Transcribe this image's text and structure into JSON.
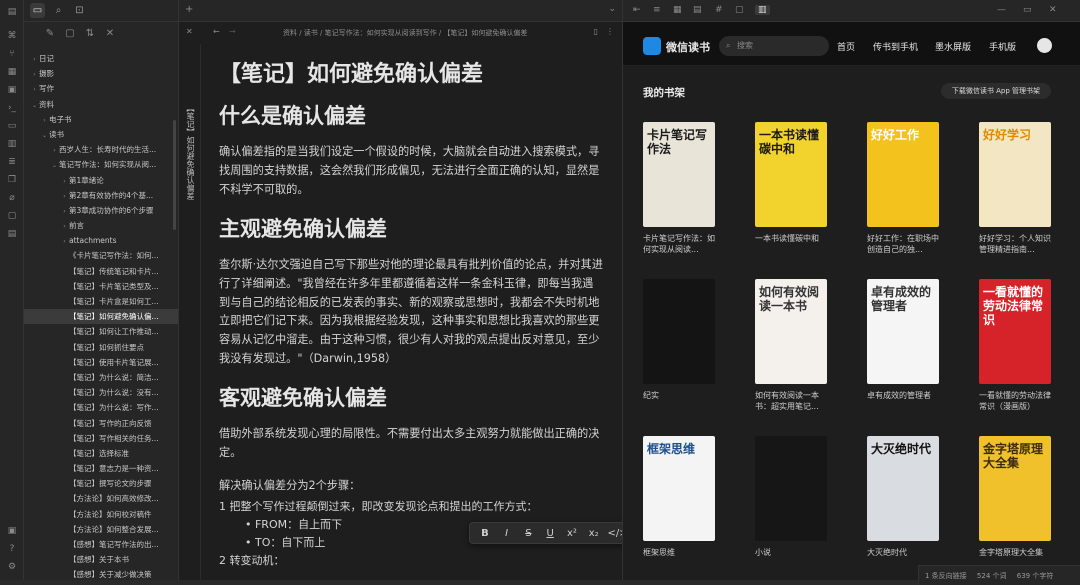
{
  "sidebar": {
    "tree": [
      {
        "label": "日记",
        "indent": 0,
        "chev": "›"
      },
      {
        "label": "摄影",
        "indent": 0,
        "chev": "›"
      },
      {
        "label": "写作",
        "indent": 0,
        "chev": "›"
      },
      {
        "label": "资料",
        "indent": 0,
        "chev": "⌄"
      },
      {
        "label": "电子书",
        "indent": 1,
        "chev": "›"
      },
      {
        "label": "读书",
        "indent": 1,
        "chev": "⌄"
      },
      {
        "label": "西岁人生：长寿时代的生活...",
        "indent": 2,
        "chev": "›"
      },
      {
        "label": "笔记写作法：如何实现从阅...",
        "indent": 2,
        "chev": "⌄"
      },
      {
        "label": "第1章绪论",
        "indent": 3,
        "chev": "›"
      },
      {
        "label": "第2章有效协作的4个基...",
        "indent": 3,
        "chev": "›"
      },
      {
        "label": "第3章成功协作的6个步骤",
        "indent": 3,
        "chev": "›"
      },
      {
        "label": "前言",
        "indent": 3,
        "chev": "›"
      },
      {
        "label": "attachments",
        "indent": 3,
        "chev": "›"
      },
      {
        "label": "《卡片笔记写作法：如何...",
        "indent": 3,
        "chev": ""
      },
      {
        "label": "【笔记】传统笔记和卡片...",
        "indent": 3,
        "chev": ""
      },
      {
        "label": "【笔记】卡片笔记类型及...",
        "indent": 3,
        "chev": ""
      },
      {
        "label": "【笔记】卡片盒是如何工...",
        "indent": 3,
        "chev": ""
      },
      {
        "label": "【笔记】如何避免确认偏...",
        "indent": 3,
        "chev": "",
        "sel": true
      },
      {
        "label": "【笔记】如何让工作推动...",
        "indent": 3,
        "chev": ""
      },
      {
        "label": "【笔记】如何抓住要点",
        "indent": 3,
        "chev": ""
      },
      {
        "label": "【笔记】使用卡片笔记展...",
        "indent": 3,
        "chev": ""
      },
      {
        "label": "【笔记】为什么说：简洁...",
        "indent": 3,
        "chev": ""
      },
      {
        "label": "【笔记】为什么说：没有...",
        "indent": 3,
        "chev": ""
      },
      {
        "label": "【笔记】为什么说：写作...",
        "indent": 3,
        "chev": ""
      },
      {
        "label": "【笔记】写作的正向反馈",
        "indent": 3,
        "chev": ""
      },
      {
        "label": "【笔记】写作相关的任务...",
        "indent": 3,
        "chev": ""
      },
      {
        "label": "【笔记】选择标准",
        "indent": 3,
        "chev": ""
      },
      {
        "label": "【笔记】意志力是一种资...",
        "indent": 3,
        "chev": ""
      },
      {
        "label": "【笔记】撰写论文的步骤",
        "indent": 3,
        "chev": ""
      },
      {
        "label": "【方法论】如何高效修改...",
        "indent": 3,
        "chev": ""
      },
      {
        "label": "【方法论】如何校对稿件",
        "indent": 3,
        "chev": ""
      },
      {
        "label": "【方法论】如何整合发展...",
        "indent": 3,
        "chev": ""
      },
      {
        "label": "【感想】笔记写作法的出...",
        "indent": 3,
        "chev": ""
      },
      {
        "label": "【感想】关于本书",
        "indent": 3,
        "chev": ""
      },
      {
        "label": "【感想】关于减少做决策",
        "indent": 3,
        "chev": ""
      }
    ]
  },
  "editor": {
    "breadcrumb": "资料 / 读书 / 笔记写作法：如何实现从阅读到写作 / 【笔记】如何避免确认偏差",
    "vertical_tab": "【笔记】如何避免确认偏差",
    "title": "【笔记】如何避免确认偏差",
    "h2_1": "什么是确认偏差",
    "p1": "确认偏差指的是当我们设定一个假设的时候，大脑就会自动进入搜索模式，寻找周围的支持数据，这会然我们形成偏见，无法进行全面正确的认知，显然是不科学不可取的。",
    "h2_2": "主观避免确认偏差",
    "p2": "查尔斯·达尔文强迫自己写下那些对他的理论最具有批判价值的论点，并对其进行了详细阐述。\"我曾经在许多年里都遵循着这样一条金科玉律，即每当我遇到与自己的结论相反的已发表的事实、新的观察或思想时，我都会不失时机地立即把它们记下来。因为我根据经验发现，这种事实和思想比我喜欢的那些更容易从记忆中溜走。由于这种习惯，很少有人对我的观点提出反对意见，至少我没有发现过。\"（Darwin,1958）",
    "h2_3": "客观避免确认偏差",
    "p3": "借助外部系统发现心理的局限性。不需要付出太多主观努力就能做出正确的决定。",
    "p4": "解决确认偏差分为2个步骤：",
    "li1": "1  把整个写作过程颠倒过来，即改变发现论点和提出的工作方式：",
    "li1a": "•  FROM：自上而下",
    "li1b": "•  TO：自下而上",
    "li2": "2  转变动机：",
    "toolbar": [
      "B",
      "I",
      "S",
      "U",
      "x²",
      "x₂",
      "</>",
      "▭",
      "❝"
    ]
  },
  "weread": {
    "name": "微信读书",
    "search_placeholder": "搜索",
    "nav": [
      "首页",
      "传书到手机",
      "墨水屏版",
      "手机版"
    ],
    "shelf_title": "我的书架",
    "download_btn": "下载微信读书 App 管理书架",
    "books": [
      {
        "title": "卡片笔记写作法：如何实现从阅读...",
        "cover_text": "卡片笔记写作法",
        "bg": "#e9e4d8",
        "fg": "#1a1a1a"
      },
      {
        "title": "一本书读懂碳中和",
        "cover_text": "一本书读懂碳中和",
        "bg": "#f2d22c",
        "fg": "#1a1a1a"
      },
      {
        "title": "好好工作：在职场中创造自己的独...",
        "cover_text": "好好工作",
        "bg": "#f3c21c",
        "fg": "#ffffff"
      },
      {
        "title": "好好学习：个人知识管理精进指南...",
        "cover_text": "好好学习",
        "bg": "#f2e6c3",
        "fg": "#e08a00"
      },
      {
        "title": "纪实",
        "cover_text": "",
        "bg": "#141414",
        "fg": "#ffffff"
      },
      {
        "title": "如何有效阅读一本书：超实用笔记...",
        "cover_text": "如何有效阅读一本书",
        "bg": "#f4f1ec",
        "fg": "#333333"
      },
      {
        "title": "卓有成效的管理者",
        "cover_text": "卓有成效的管理者",
        "bg": "#f5f5f5",
        "fg": "#333333"
      },
      {
        "title": "一看就懂的劳动法律常识（漫画版）",
        "cover_text": "一看就懂的劳动法律常识",
        "bg": "#d6232a",
        "fg": "#ffffff"
      },
      {
        "title": "框架思维",
        "cover_text": "框架思维",
        "bg": "#f4f4f4",
        "fg": "#1d4f8f"
      },
      {
        "title": "小说",
        "cover_text": "",
        "bg": "#161616",
        "fg": "#ffffff"
      },
      {
        "title": "大灭绝时代",
        "cover_text": "大灭绝时代",
        "bg": "#d9dde1",
        "fg": "#111111"
      },
      {
        "title": "金字塔原理大全集",
        "cover_text": "金字塔原理大全集",
        "bg": "#f1c12b",
        "fg": "#3b2a10"
      }
    ]
  },
  "status": {
    "backlinks": "1 条反向链接",
    "words": "524 个词",
    "chars": "639 个字符"
  }
}
